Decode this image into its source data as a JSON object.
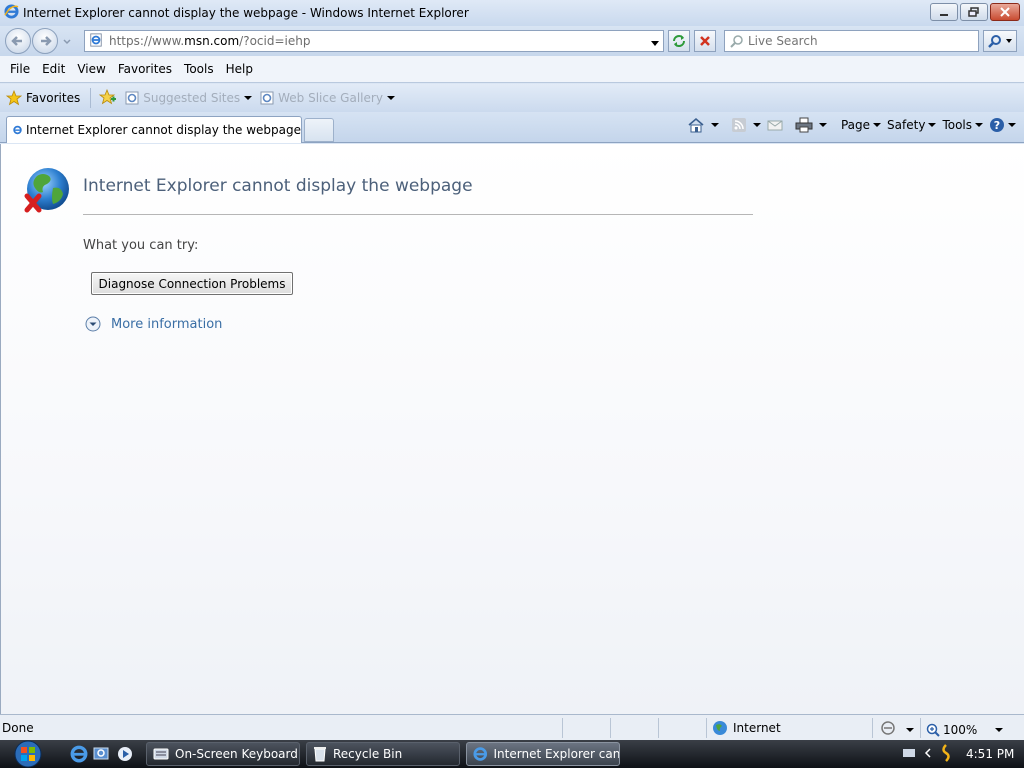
{
  "window": {
    "title": "Internet Explorer cannot display the webpage - Windows Internet Explorer"
  },
  "address": {
    "url_prefix": "https://www.",
    "url_domain": "msn.com",
    "url_suffix": "/?ocid=iehp",
    "search_placeholder": "Live Search"
  },
  "menu": {
    "items": [
      "File",
      "Edit",
      "View",
      "Favorites",
      "Tools",
      "Help"
    ]
  },
  "favorites_bar": {
    "favorites_label": "Favorites",
    "suggested_sites": "Suggested Sites",
    "web_slice_gallery": "Web Slice Gallery"
  },
  "tab": {
    "label": "Internet Explorer cannot display the webpage"
  },
  "commands": {
    "page": "Page",
    "safety": "Safety",
    "tools": "Tools"
  },
  "error_page": {
    "title": "Internet Explorer cannot display the webpage",
    "try_label": "What you can try:",
    "diagnose_button": "Diagnose Connection Problems",
    "more_info": "More information"
  },
  "status": {
    "text": "Done",
    "zone": "Internet",
    "zoom": "100%"
  },
  "taskbar": {
    "tasks": [
      "On-Screen Keyboard",
      "Recycle Bin",
      "Internet Explorer can..."
    ],
    "clock": "4:51 PM"
  },
  "colors": {
    "title_text": "#4c607a",
    "link": "#3a6ea5",
    "taskbar": "#1a1e24"
  }
}
